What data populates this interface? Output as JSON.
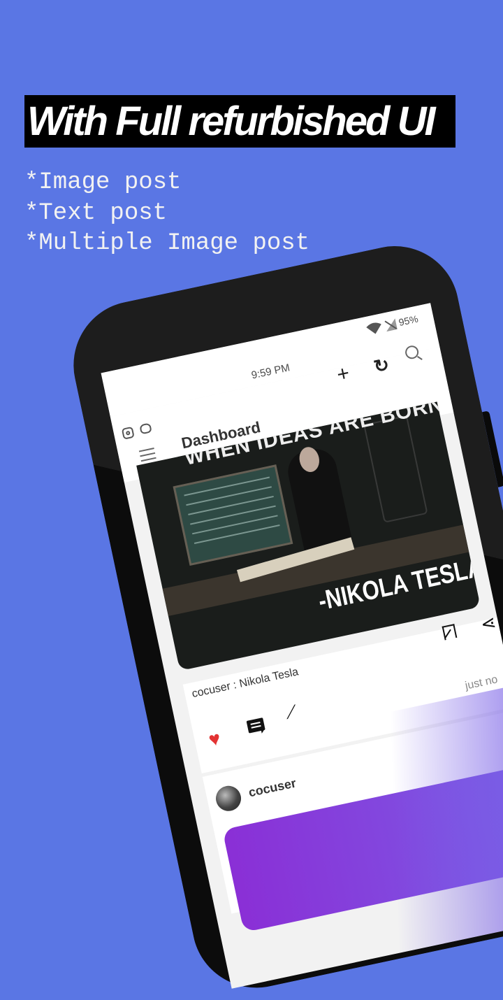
{
  "promo": {
    "headline": "With Full refurbished UI",
    "features": [
      "*Image post",
      "*Text post",
      "*Multiple Image post"
    ]
  },
  "status_bar": {
    "time": "9:59 PM",
    "battery": "95%"
  },
  "app_bar": {
    "title": "Dashboard"
  },
  "post": {
    "image_top_text": "WHEN IDEAS ARE BORN.",
    "image_caption": "-NIKOLA TESLA",
    "caption": "cocuser : Nikola Tesla",
    "time_ago": "just no"
  },
  "next_post": {
    "username": "cocuser"
  },
  "colors": {
    "background": "#5a76e4",
    "like": "#e33333",
    "card_gradient_start": "#8a2fd6",
    "card_gradient_end": "#7b5ee6"
  }
}
